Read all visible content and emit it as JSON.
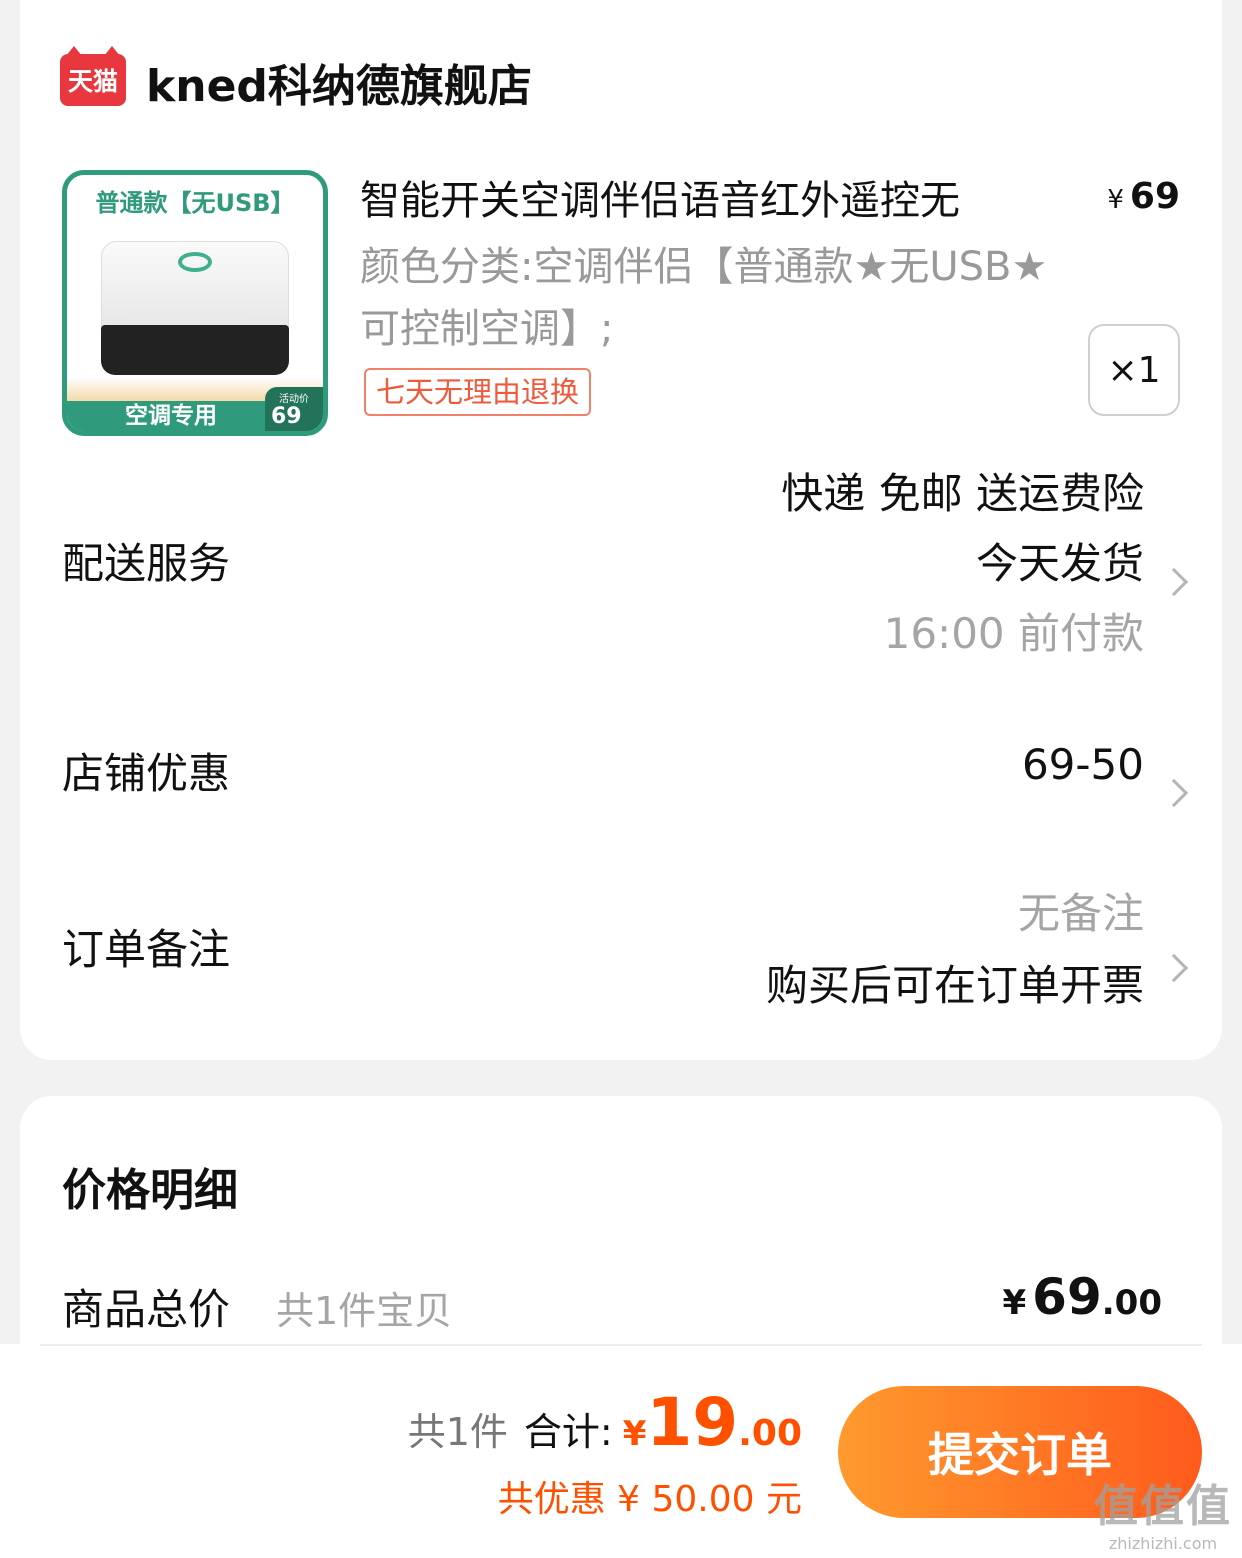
{
  "shop": {
    "logo_text": "天猫",
    "name": "kned科纳德旗舰店"
  },
  "product": {
    "image": {
      "title": "普通款【无USB】",
      "band_text": "空调专用",
      "badge_label": "活动价",
      "badge_price": "69"
    },
    "title": "智能开关空调伴侣语音红外遥控无",
    "spec": "颜色分类:空调伴侣【普通款★无USB★可控制空调】;",
    "return_tag": "七天无理由退换",
    "price_symbol": "¥",
    "price": "69",
    "quantity": "×1"
  },
  "delivery": {
    "label": "配送服务",
    "line1": "快递 免邮 送运费险",
    "line2": "今天发货",
    "line3": "16:00 前付款"
  },
  "coupon": {
    "label": "店铺优惠",
    "value": "69-50"
  },
  "note": {
    "label": "订单备注",
    "value": "无备注",
    "invoice": "购买后可在订单开票"
  },
  "price_detail": {
    "heading": "价格明细",
    "total_label": "商品总价",
    "total_sub": "共1件宝贝",
    "symbol": "¥",
    "total_int": "69",
    "total_dec": ".00"
  },
  "bottom_bar": {
    "count": "共1件",
    "sum_label": "合计:",
    "symbol": "¥",
    "sum_int": "19",
    "sum_dec": ".00",
    "discount": "共优惠 ¥ 50.00 元",
    "submit_label": "提交订单"
  },
  "watermark": {
    "big": "值值值",
    "small": "zhizhizhi.com"
  },
  "colors": {
    "accent": "#ff5000",
    "tmall_red": "#e8373f",
    "product_green": "#2f9b7c"
  }
}
